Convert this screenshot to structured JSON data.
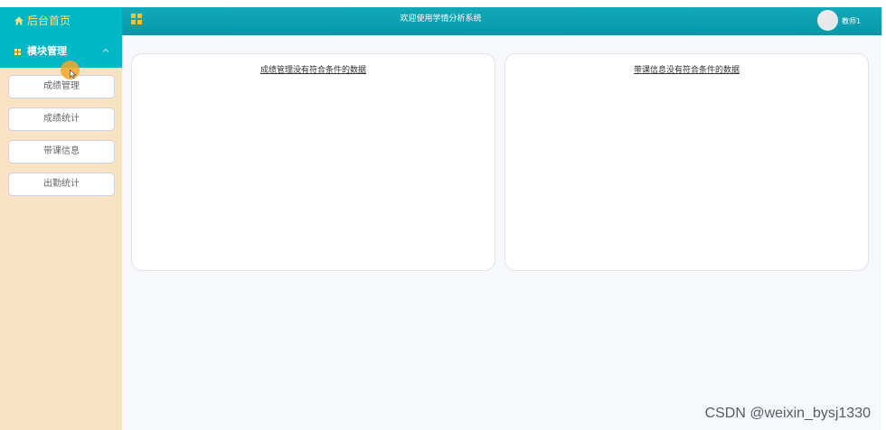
{
  "header": {
    "home_label": "后台首页",
    "welcome_text": "欢迎使用学情分析系统",
    "user_name": "教师1"
  },
  "sidebar": {
    "module_label": "模块管理",
    "items": [
      {
        "label": "成绩管理"
      },
      {
        "label": "成绩统计"
      },
      {
        "label": "带课信息"
      },
      {
        "label": "出勤统计"
      }
    ]
  },
  "main": {
    "cards": [
      {
        "message": "成绩管理没有符合条件的数据"
      },
      {
        "message": "带课信息没有符合条件的数据"
      }
    ]
  },
  "watermark": "CSDN @weixin_bysj1330",
  "colors": {
    "topbar": "#0897a8",
    "sidebar_header": "#00b7c6",
    "sidebar_bg": "#f9e1c4",
    "home_text": "#fde07a",
    "grid_icon": "#f6c233",
    "cursor_highlight": "#f2a928"
  },
  "icons": {
    "home": "home-icon",
    "grid": "grid-icon",
    "module": "module-grid-icon",
    "collapse": "chevron-up-icon"
  }
}
